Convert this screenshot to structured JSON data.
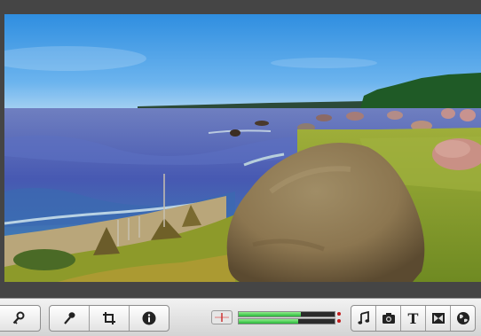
{
  "viewer": {
    "scene": "beach-landscape-frame"
  },
  "toolbar": {
    "left_buttons": [
      {
        "icon": "key-icon",
        "name": "keyword-button"
      }
    ],
    "middle_buttons": [
      {
        "icon": "microphone-icon",
        "name": "voiceover-button"
      },
      {
        "icon": "crop-icon",
        "name": "crop-button"
      },
      {
        "icon": "info-icon",
        "name": "info-button"
      }
    ],
    "audio_meters": {
      "left_level": 0.65,
      "right_level": 0.62
    },
    "right_buttons": [
      {
        "icon": "music-note-icon",
        "name": "music-button"
      },
      {
        "icon": "camera-icon",
        "name": "photos-button"
      },
      {
        "icon": "title-icon",
        "name": "titles-button",
        "label": "T"
      },
      {
        "icon": "transitions-icon",
        "name": "transitions-button"
      },
      {
        "icon": "globe-icon",
        "name": "maps-button"
      }
    ]
  },
  "colors": {
    "sky": "#4a9ee3",
    "water": "#4b5fb0",
    "grass": "#8a9a2c",
    "rock": "#8d7a55",
    "meter_green": "#3ccf4a",
    "meter_peak": "#c11c1c"
  }
}
